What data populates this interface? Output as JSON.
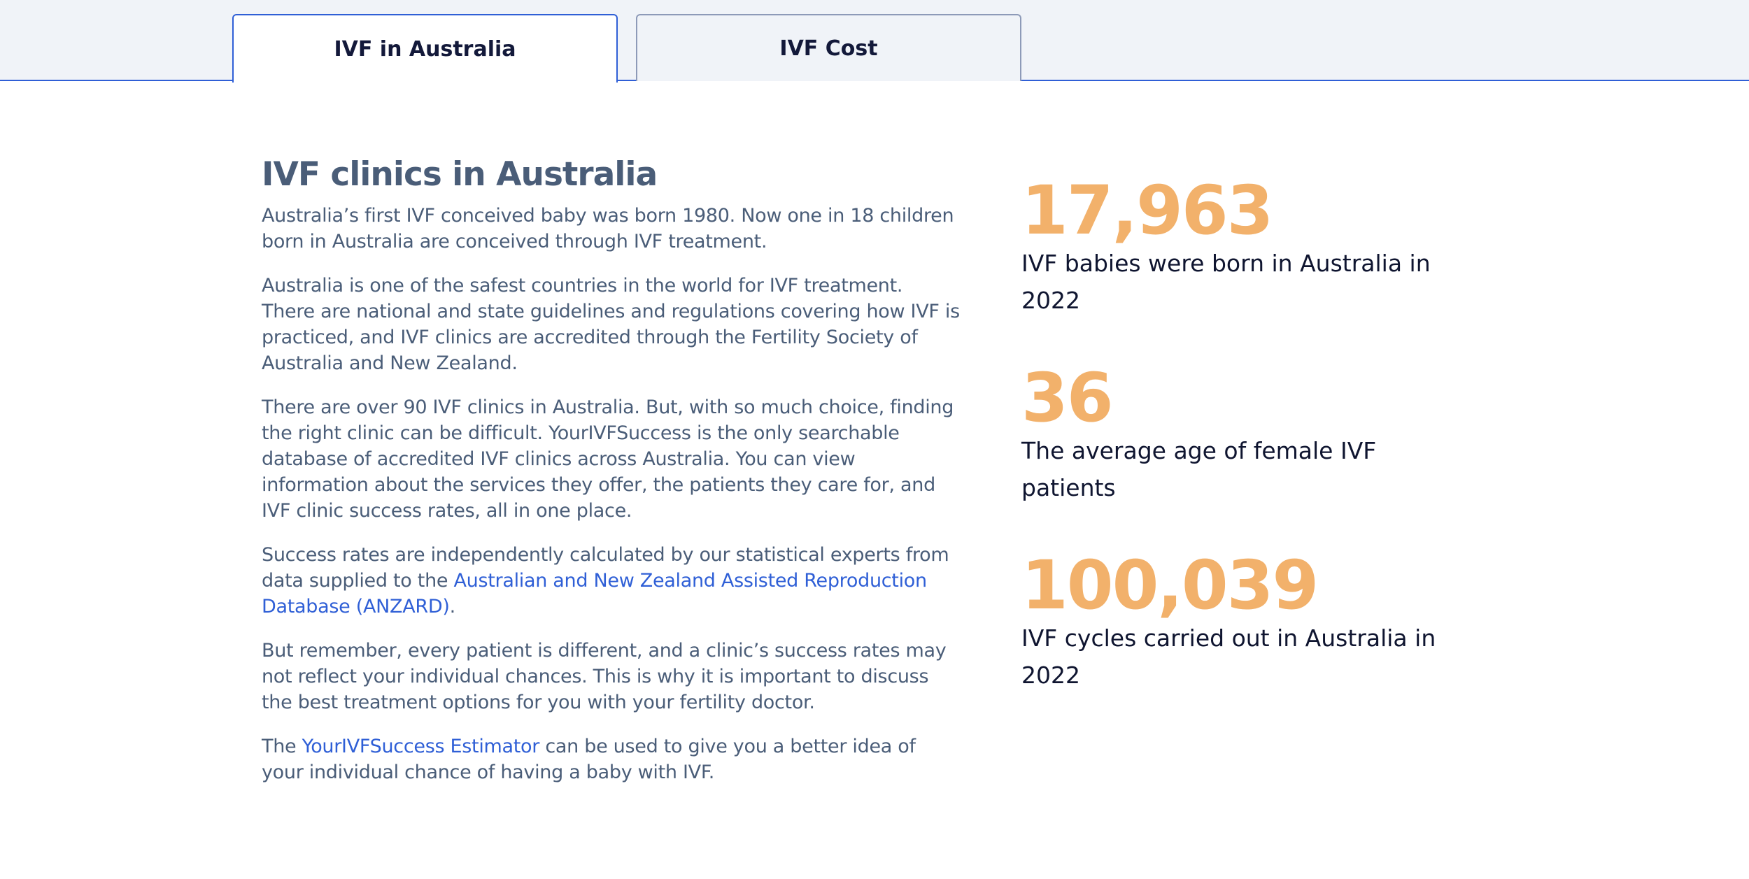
{
  "tabs": [
    {
      "label": "IVF in Australia",
      "active": true
    },
    {
      "label": "IVF Cost",
      "active": false
    }
  ],
  "main": {
    "heading": "IVF clinics in Australia",
    "p1": "Australia’s first IVF conceived baby was born 1980. Now one in 18 children born in Australia are conceived through IVF treatment.",
    "p2": "Australia is one of the safest countries in the world for IVF treatment.  There are national and state guidelines and regulations covering how IVF is practiced, and IVF clinics are accredited through the Fertility Society of Australia and New Zealand.",
    "p3": "There are over 90 IVF clinics in Australia. But, with so much choice, finding the right clinic can be difficult. YourIVFSuccess is the only searchable database of accredited IVF clinics across Australia. You can view information about the services they offer, the patients they care for, and IVF clinic success rates, all in one place.",
    "p4_before": "Success rates are independently calculated by our statistical experts from data supplied to the ",
    "p4_link": "Australian and New Zealand Assisted Reproduction Database (ANZARD)",
    "p4_after": ".",
    "p5": "But remember, every patient is different, and a clinic’s success rates may not reflect your individual chances. This is why it is important to discuss the best treatment options for you with your fertility doctor.",
    "p6_before": "The ",
    "p6_link": "YourIVFSuccess Estimator",
    "p6_after": " can be used to give you a better idea of your individual chance of having a baby with IVF."
  },
  "stats": [
    {
      "number": "17,963",
      "label": "IVF babies were born in Australia in 2022"
    },
    {
      "number": "36",
      "label": "The average age of female IVF patients"
    },
    {
      "number": "100,039",
      "label": "IVF cycles carried out in Australia in 2022"
    }
  ],
  "colors": {
    "accent": "#2f5fd6",
    "stat_number": "#f2b16b",
    "body_text": "#4a5d78",
    "tab_background": "#f0f3f8"
  }
}
